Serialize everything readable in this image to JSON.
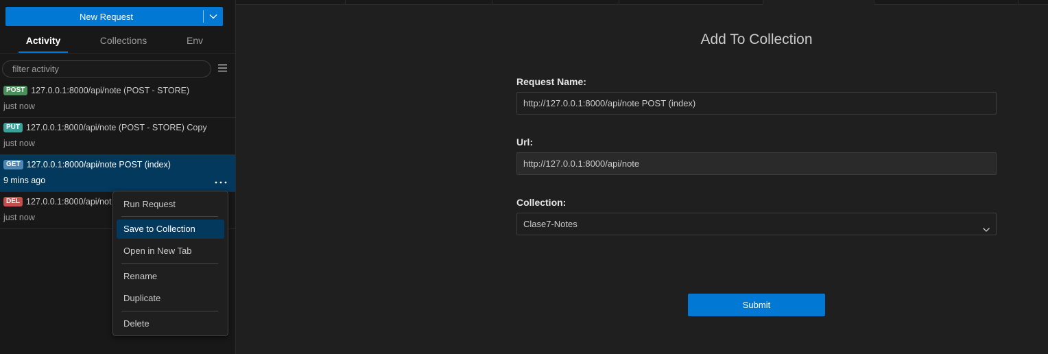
{
  "sidebar": {
    "new_request_label": "New Request",
    "tabs": [
      {
        "label": "Activity"
      },
      {
        "label": "Collections"
      },
      {
        "label": "Env"
      }
    ],
    "filter_placeholder": "filter activity",
    "activity": [
      {
        "method": "POST",
        "method_color": "#4a8f5b",
        "label": "127.0.0.1:8000/api/note (POST - STORE)",
        "time": "just now"
      },
      {
        "method": "PUT",
        "method_color": "#3aa19b",
        "label": "127.0.0.1:8000/api/note (POST - STORE) Copy",
        "time": "just now"
      },
      {
        "method": "GET",
        "method_color": "#4f86b3",
        "label": "127.0.0.1:8000/api/note POST (index)",
        "time": "9 mins ago"
      },
      {
        "method": "DEL",
        "method_color": "#c24e4e",
        "label": "127.0.0.1:8000/api/not",
        "time": "just now"
      }
    ]
  },
  "context_menu": {
    "items": [
      "Run Request",
      "Save to Collection",
      "Open in New Tab",
      "Rename",
      "Duplicate",
      "Delete"
    ]
  },
  "form": {
    "title": "Add To Collection",
    "request_name_label": "Request Name:",
    "request_name_value": "http://127.0.0.1:8000/api/note POST (index)",
    "url_label": "Url:",
    "url_value": "http://127.0.0.1:8000/api/note",
    "collection_label": "Collection:",
    "collection_value": "Clase7-Notes",
    "submit_label": "Submit"
  },
  "colors": {
    "accent": "#0078d4",
    "selection": "#04395e"
  }
}
